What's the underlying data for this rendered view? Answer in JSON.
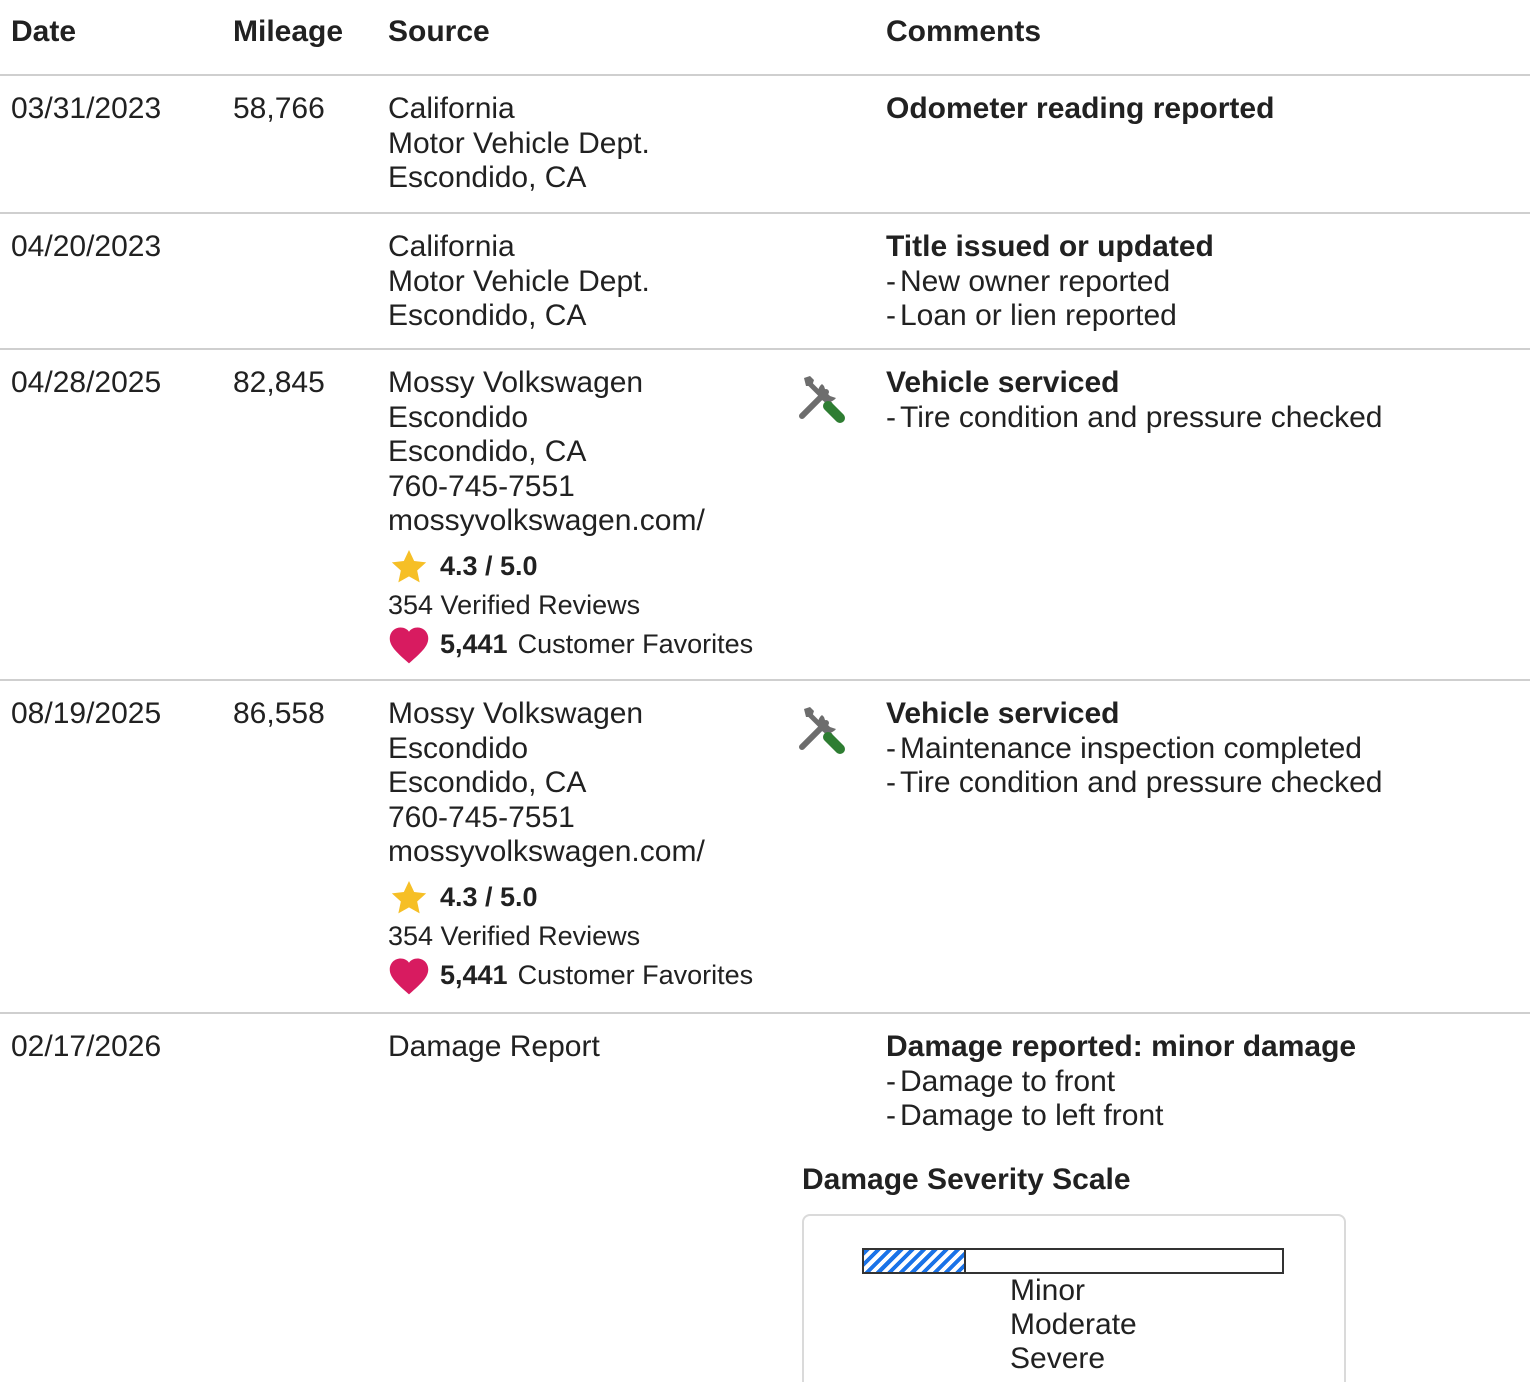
{
  "headers": {
    "date": "Date",
    "mileage": "Mileage",
    "source": "Source",
    "comments": "Comments"
  },
  "rows": [
    {
      "date": "03/31/2023",
      "mileage": "58,766",
      "source": [
        "California",
        "Motor Vehicle Dept.",
        "Escondido, CA"
      ],
      "comment_title": "Odometer reading reported",
      "bullets": []
    },
    {
      "date": "04/20/2023",
      "mileage": "",
      "source": [
        "California",
        "Motor Vehicle Dept.",
        "Escondido, CA"
      ],
      "comment_title": "Title issued or updated",
      "bullets": [
        "New owner reported",
        "Loan or lien reported"
      ]
    },
    {
      "date": "04/28/2025",
      "mileage": "82,845",
      "source": [
        "Mossy Volkswagen",
        "Escondido",
        "Escondido, CA",
        "760-745-7551",
        "mossyvolkswagen.com/"
      ],
      "rating": "4.3 / 5.0",
      "reviews": "354 Verified Reviews",
      "favorites_count": "5,441",
      "favorites_label": "Customer Favorites",
      "icon": "service-tools-icon",
      "comment_title": "Vehicle serviced",
      "bullets": [
        "Tire condition and pressure checked"
      ]
    },
    {
      "date": "08/19/2025",
      "mileage": "86,558",
      "source": [
        "Mossy Volkswagen",
        "Escondido",
        "Escondido, CA",
        "760-745-7551",
        "mossyvolkswagen.com/"
      ],
      "rating": "4.3 / 5.0",
      "reviews": "354 Verified Reviews",
      "favorites_count": "5,441",
      "favorites_label": "Customer Favorites",
      "icon": "service-tools-icon",
      "comment_title": "Vehicle serviced",
      "bullets": [
        "Maintenance inspection completed",
        "Tire condition and pressure checked"
      ]
    },
    {
      "date": "02/17/2026",
      "mileage": "",
      "source": [
        "Damage Report"
      ],
      "comment_title": "Damage reported: minor damage",
      "bullets": [
        "Damage to front",
        "Damage to left front"
      ]
    }
  ],
  "bullet_dash": "-",
  "damage_scale": {
    "title": "Damage Severity Scale",
    "levels": [
      "Minor",
      "Moderate",
      "Severe"
    ],
    "selected_fraction": 0.24
  },
  "colors": {
    "star": "#f6bf26",
    "heart": "#d81b60",
    "bar_fill": "#1a73e8",
    "tool_green": "#2e7d32",
    "tool_gray": "#6d6d6d",
    "divider": "#cfcfcf"
  }
}
